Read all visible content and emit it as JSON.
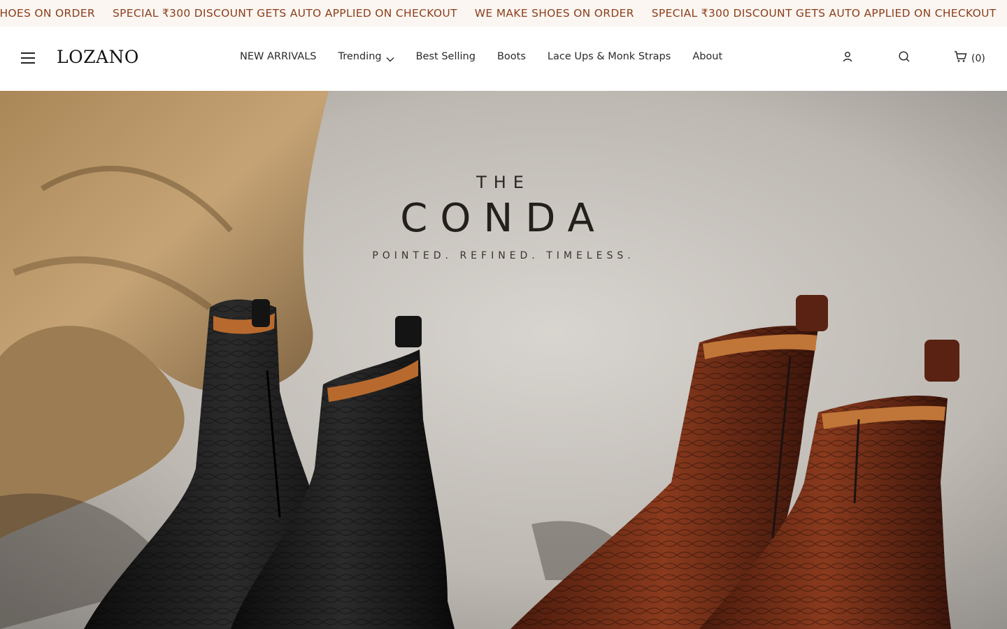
{
  "announcement": {
    "items": [
      "WE MAKE SHOES ON ORDER",
      "SPECIAL ₹300 DISCOUNT GETS AUTO APPLIED ON CHECKOUT",
      "WE MAKE SHOES ON ORDER",
      "SPECIAL ₹300 DISCOUNT GETS AUTO APPLIED ON CHECKOUT"
    ],
    "color": "#8b3e1d",
    "background": "#fbf6f1"
  },
  "header": {
    "logo": "LOZANO",
    "nav": [
      {
        "label": "NEW ARRIVALS"
      },
      {
        "label": "Trending",
        "has_dropdown": true
      },
      {
        "label": "Best Selling"
      },
      {
        "label": "Boots"
      },
      {
        "label": "Lace Ups & Monk Straps"
      },
      {
        "label": "About"
      }
    ],
    "icons": [
      "menu-icon",
      "account-icon",
      "search-icon",
      "cart-icon"
    ],
    "cart_count": "(0)"
  },
  "hero": {
    "eyebrow": "THE",
    "title": "CONDA",
    "tagline": "POINTED. REFINED. TIMELESS.",
    "image": "black-and-brown-croc-embossed-chelsea-boots"
  }
}
